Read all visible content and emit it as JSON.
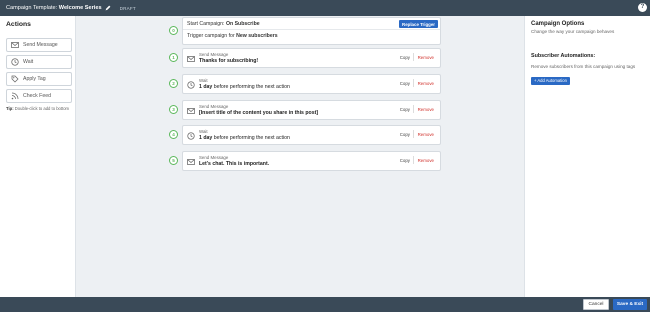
{
  "header": {
    "title_prefix": "Campaign Template: ",
    "title_name": "Welcome Series",
    "status": "DRAFT",
    "help": "?"
  },
  "actions": {
    "title": "Actions",
    "items": [
      {
        "label": "Send Message",
        "icon": "envelope-icon"
      },
      {
        "label": "Wait",
        "icon": "clock-icon"
      },
      {
        "label": "Apply Tag",
        "icon": "tag-icon"
      },
      {
        "label": "Check Feed",
        "icon": "rss-icon"
      }
    ],
    "tip_label": "Tip:",
    "tip_text": " Double-click to add to bottom"
  },
  "trigger": {
    "start_label": "Start Campaign: ",
    "start_value": "On Subscribe",
    "replace_label": "Replace Trigger",
    "desc_prefix": "Trigger campaign for ",
    "desc_value": "New subscribers",
    "step_number": "0"
  },
  "steps": [
    {
      "number": "1",
      "kind": "Send Message",
      "icon": "envelope-icon",
      "bold": "Thanks for subscribing!",
      "rest": ""
    },
    {
      "number": "2",
      "kind": "Wait",
      "icon": "clock-icon",
      "bold": "1 day",
      "rest": " before performing the next action"
    },
    {
      "number": "3",
      "kind": "Send Message",
      "icon": "envelope-icon",
      "bold": "[Insert title of the content you share in this post]",
      "rest": ""
    },
    {
      "number": "4",
      "kind": "Wait",
      "icon": "clock-icon",
      "bold": "1 day",
      "rest": " before performing the next action"
    },
    {
      "number": "5",
      "kind": "Send Message",
      "icon": "envelope-icon",
      "bold": "Let's chat. This is important.",
      "rest": ""
    }
  ],
  "step_actions": {
    "copy": "Copy",
    "remove": "Remove"
  },
  "options": {
    "title": "Campaign Options",
    "subtitle": "Change the way your campaign behaves",
    "automations_title": "Subscriber Automations:",
    "automations_desc": "Remove subscribers from this campaign using tags",
    "add_label": "+ Add Automation"
  },
  "footer": {
    "cancel": "Cancel",
    "save": "Save & Exit"
  },
  "colors": {
    "accent": "#2a69c4",
    "topbar": "#3a4a58",
    "step_ring": "#5cb85c",
    "remove": "#d0302a"
  }
}
